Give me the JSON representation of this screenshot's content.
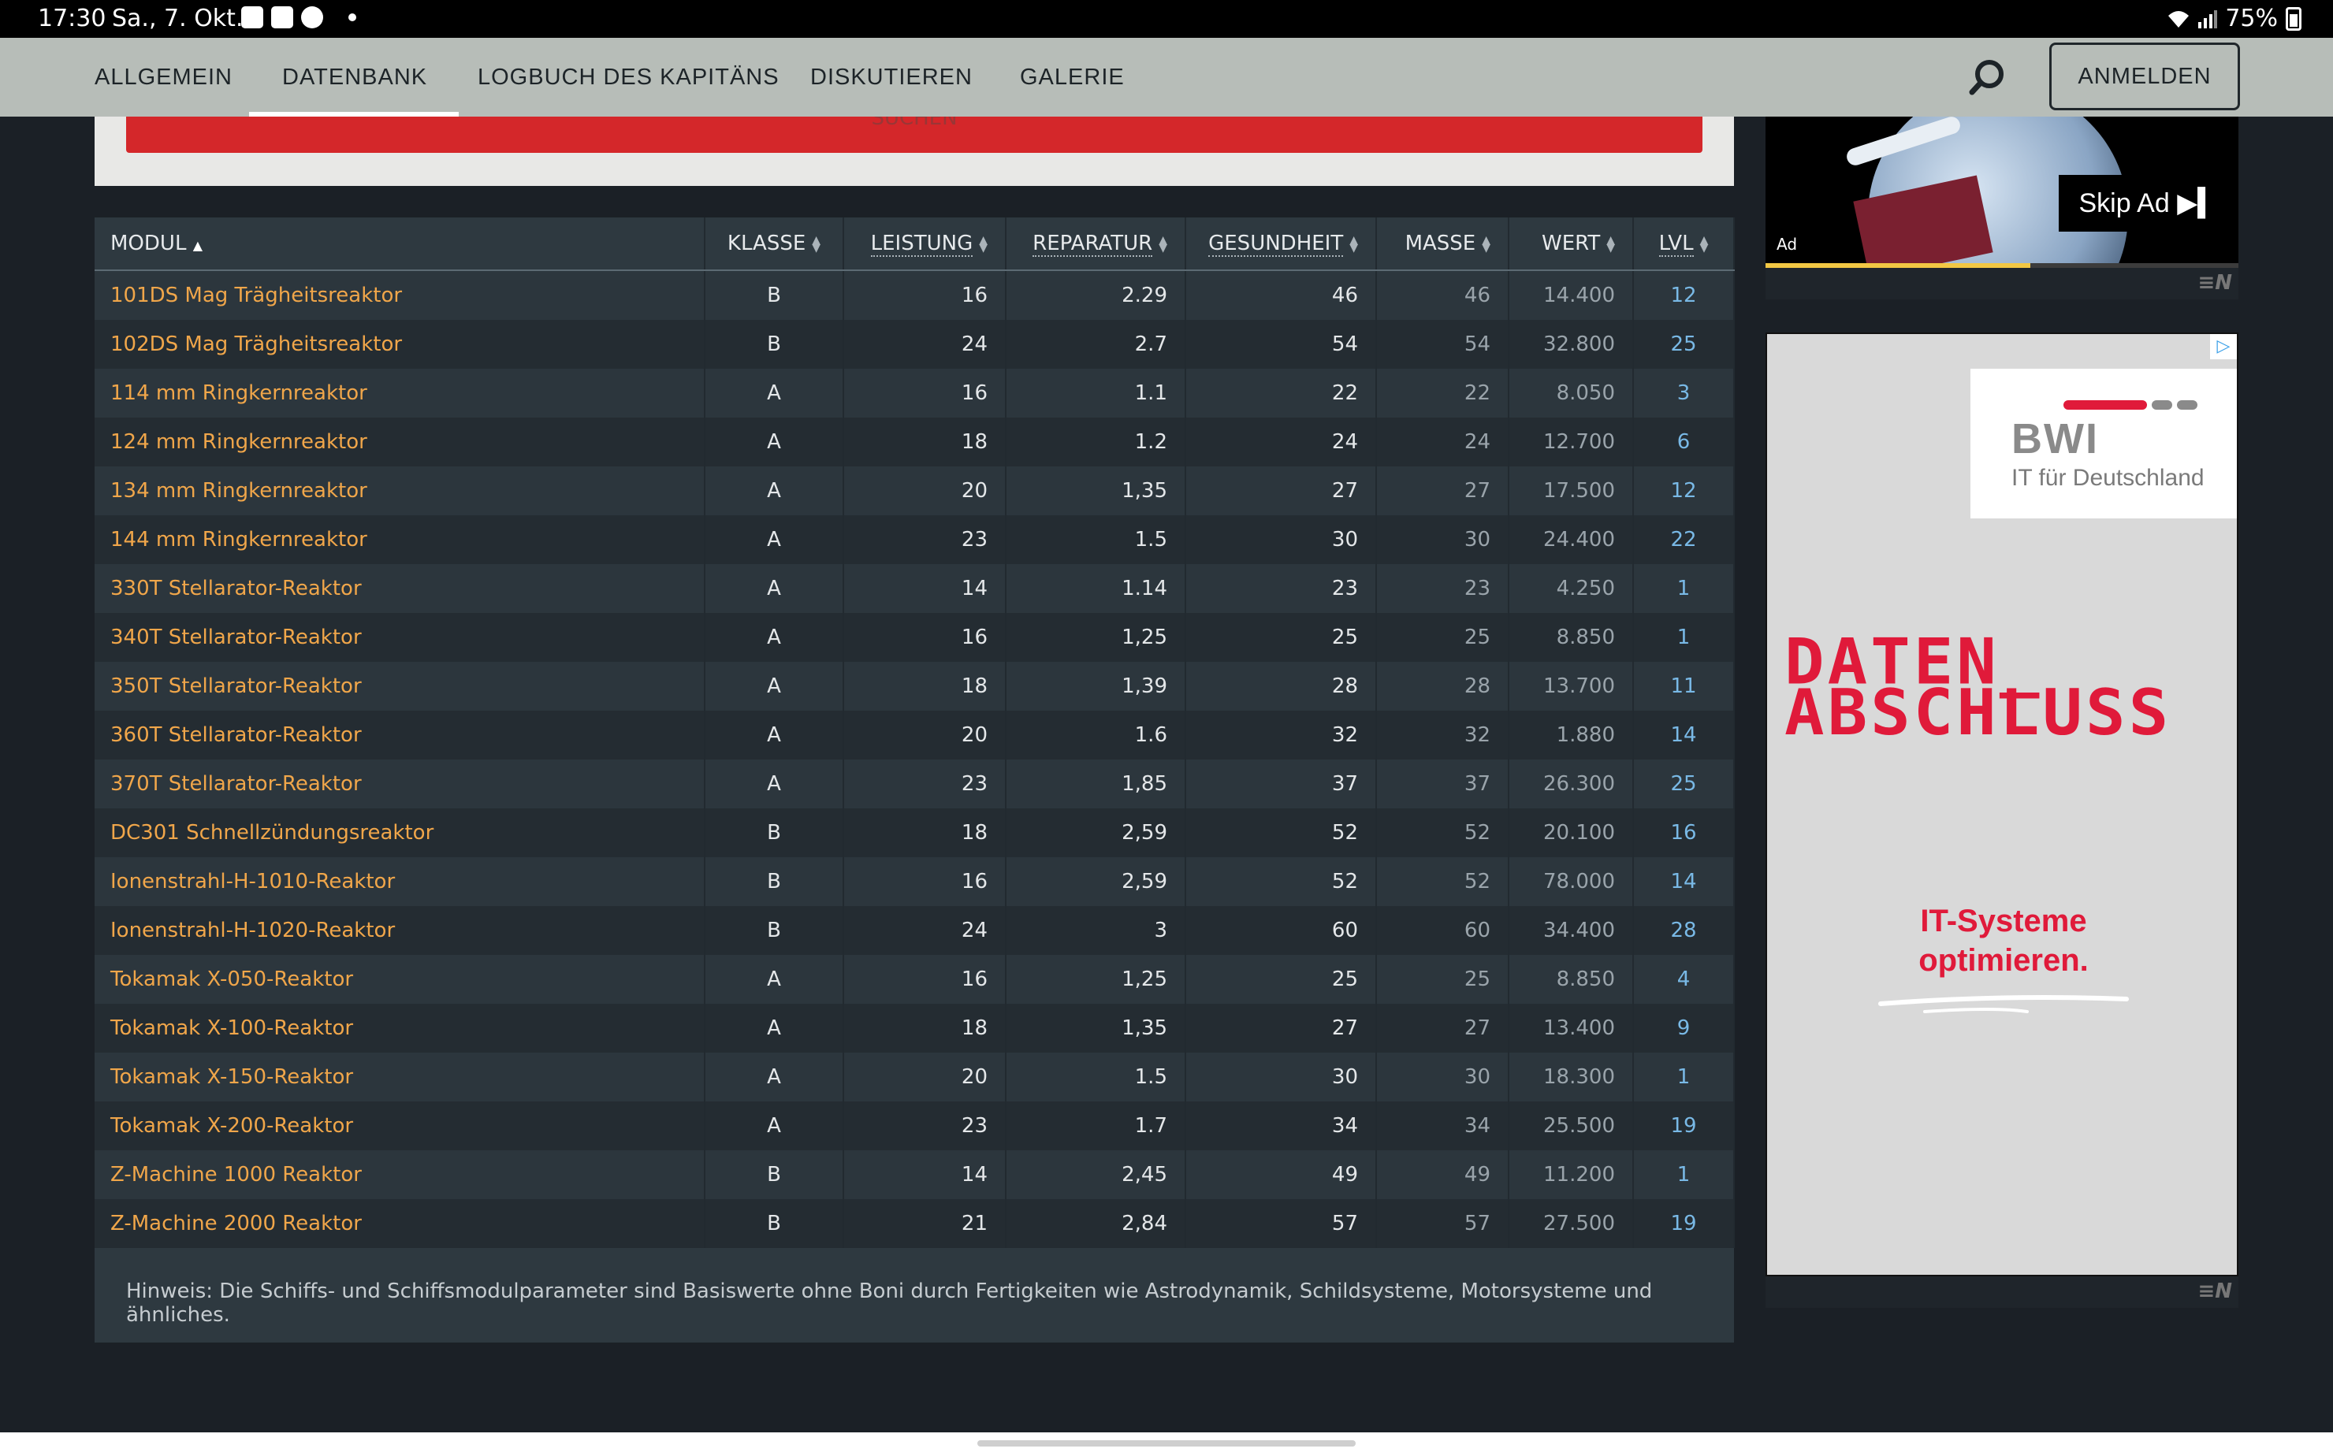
{
  "status_bar": {
    "time": "17:30",
    "date": "Sa., 7. Okt.",
    "battery": "75%"
  },
  "nav": {
    "tabs": [
      "ALLGEMEIN",
      "DATENBANK",
      "LOGBUCH DES KAPITÄNS",
      "DISKUTIEREN",
      "GALERIE"
    ],
    "active_tab": "DATENBANK",
    "login_label": "ANMELDEN"
  },
  "search": {
    "submit_label": "SUCHEN"
  },
  "table": {
    "columns": [
      "MODUL",
      "KLASSE",
      "LEISTUNG",
      "REPARATUR",
      "GESUNDHEIT",
      "MASSE",
      "WERT",
      "LVL"
    ],
    "rows": [
      {
        "modul": "101DS Mag Trägheitsreaktor",
        "klasse": "B",
        "leistung": "16",
        "reparatur": "2.29",
        "gesundheit": "46",
        "masse": "46",
        "wert": "14.400",
        "lvl": "12"
      },
      {
        "modul": "102DS Mag Trägheitsreaktor",
        "klasse": "B",
        "leistung": "24",
        "reparatur": "2.7",
        "gesundheit": "54",
        "masse": "54",
        "wert": "32.800",
        "lvl": "25"
      },
      {
        "modul": "114 mm Ringkernreaktor",
        "klasse": "A",
        "leistung": "16",
        "reparatur": "1.1",
        "gesundheit": "22",
        "masse": "22",
        "wert": "8.050",
        "lvl": "3"
      },
      {
        "modul": "124 mm Ringkernreaktor",
        "klasse": "A",
        "leistung": "18",
        "reparatur": "1.2",
        "gesundheit": "24",
        "masse": "24",
        "wert": "12.700",
        "lvl": "6"
      },
      {
        "modul": "134 mm Ringkernreaktor",
        "klasse": "A",
        "leistung": "20",
        "reparatur": "1,35",
        "gesundheit": "27",
        "masse": "27",
        "wert": "17.500",
        "lvl": "12"
      },
      {
        "modul": "144 mm Ringkernreaktor",
        "klasse": "A",
        "leistung": "23",
        "reparatur": "1.5",
        "gesundheit": "30",
        "masse": "30",
        "wert": "24.400",
        "lvl": "22"
      },
      {
        "modul": "330T Stellarator-Reaktor",
        "klasse": "A",
        "leistung": "14",
        "reparatur": "1.14",
        "gesundheit": "23",
        "masse": "23",
        "wert": "4.250",
        "lvl": "1"
      },
      {
        "modul": "340T Stellarator-Reaktor",
        "klasse": "A",
        "leistung": "16",
        "reparatur": "1,25",
        "gesundheit": "25",
        "masse": "25",
        "wert": "8.850",
        "lvl": "1"
      },
      {
        "modul": "350T Stellarator-Reaktor",
        "klasse": "A",
        "leistung": "18",
        "reparatur": "1,39",
        "gesundheit": "28",
        "masse": "28",
        "wert": "13.700",
        "lvl": "11"
      },
      {
        "modul": "360T Stellarator-Reaktor",
        "klasse": "A",
        "leistung": "20",
        "reparatur": "1.6",
        "gesundheit": "32",
        "masse": "32",
        "wert": "1.880",
        "lvl": "14"
      },
      {
        "modul": "370T Stellarator-Reaktor",
        "klasse": "A",
        "leistung": "23",
        "reparatur": "1,85",
        "gesundheit": "37",
        "masse": "37",
        "wert": "26.300",
        "lvl": "25"
      },
      {
        "modul": "DC301 Schnellzündungsreaktor",
        "klasse": "B",
        "leistung": "18",
        "reparatur": "2,59",
        "gesundheit": "52",
        "masse": "52",
        "wert": "20.100",
        "lvl": "16"
      },
      {
        "modul": "Ionenstrahl-H-1010-Reaktor",
        "klasse": "B",
        "leistung": "16",
        "reparatur": "2,59",
        "gesundheit": "52",
        "masse": "52",
        "wert": "78.000",
        "lvl": "14"
      },
      {
        "modul": "Ionenstrahl-H-1020-Reaktor",
        "klasse": "B",
        "leistung": "24",
        "reparatur": "3",
        "gesundheit": "60",
        "masse": "60",
        "wert": "34.400",
        "lvl": "28"
      },
      {
        "modul": "Tokamak X-050-Reaktor",
        "klasse": "A",
        "leistung": "16",
        "reparatur": "1,25",
        "gesundheit": "25",
        "masse": "25",
        "wert": "8.850",
        "lvl": "4"
      },
      {
        "modul": "Tokamak X-100-Reaktor",
        "klasse": "A",
        "leistung": "18",
        "reparatur": "1,35",
        "gesundheit": "27",
        "masse": "27",
        "wert": "13.400",
        "lvl": "9"
      },
      {
        "modul": "Tokamak X-150-Reaktor",
        "klasse": "A",
        "leistung": "20",
        "reparatur": "1.5",
        "gesundheit": "30",
        "masse": "30",
        "wert": "18.300",
        "lvl": "1"
      },
      {
        "modul": "Tokamak X-200-Reaktor",
        "klasse": "A",
        "leistung": "23",
        "reparatur": "1.7",
        "gesundheit": "34",
        "masse": "34",
        "wert": "25.500",
        "lvl": "19"
      },
      {
        "modul": "Z-Machine 1000 Reaktor",
        "klasse": "B",
        "leistung": "14",
        "reparatur": "2,45",
        "gesundheit": "49",
        "masse": "49",
        "wert": "11.200",
        "lvl": "1"
      },
      {
        "modul": "Z-Machine 2000 Reaktor",
        "klasse": "B",
        "leistung": "21",
        "reparatur": "2,84",
        "gesundheit": "57",
        "masse": "57",
        "wert": "27.500",
        "lvl": "19"
      }
    ],
    "note": "Hinweis: Die Schiffs- und Schiffsmodulparameter sind Basiswerte ohne Boni durch Fertigkeiten wie Astrodynamik, Schildsysteme, Motorsysteme und ähnliches."
  },
  "ads": {
    "video_ad": {
      "ad_label": "Ad",
      "skip_label": "Skip Ad",
      "progress": 0.56
    },
    "banner": {
      "brand": "BWI",
      "tagline": "IT für Deutschland",
      "headline_1": "DATEN_",
      "headline_2": "ABSCHLUSS",
      "cta": "IT-Systeme optimieren."
    }
  },
  "colors": {
    "nav_bg": "#b7bdb8",
    "page_bg": "#1b2026",
    "link": "#f0a64a",
    "lvl": "#79b9e6",
    "accent_red": "#e01a3a"
  }
}
